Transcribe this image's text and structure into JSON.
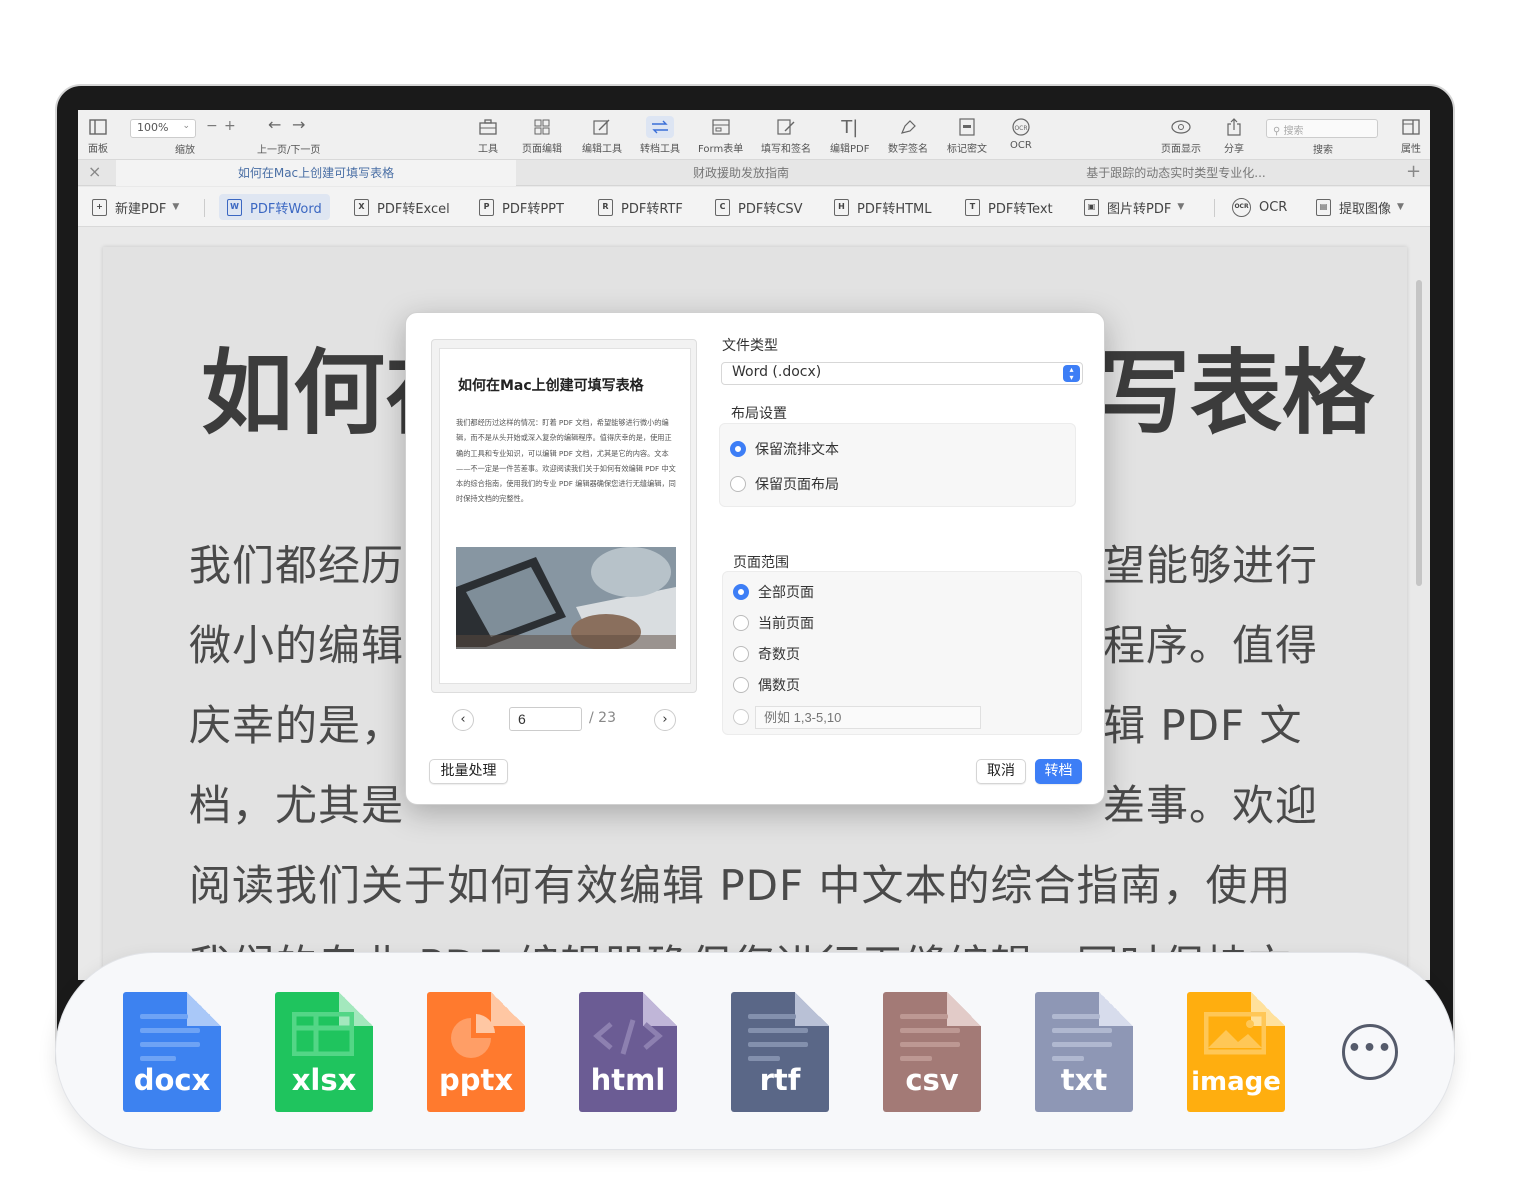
{
  "toolbar": {
    "panel": "面板",
    "zoom_value": "100%",
    "zoom_label": "缩放",
    "prev_next": "上一页/下一页",
    "tools": "工具",
    "page_edit": "页面编辑",
    "edit_tools": "编辑工具",
    "convert_tools": "转档工具",
    "form": "Form表单",
    "fill_sign": "填写和签名",
    "edit_pdf": "编辑PDF",
    "digital_sign": "数字签名",
    "redact": "标记密文",
    "ocr": "OCR",
    "page_display": "页面显示",
    "share": "分享",
    "search_placeholder": "搜索",
    "search_label": "搜索",
    "properties": "属性"
  },
  "tabs": [
    {
      "label": "如何在Mac上创建可填写表格"
    },
    {
      "label": "财政援助发放指南"
    },
    {
      "label": "基于跟踪的动态实时类型专业化..."
    }
  ],
  "convert_bar": {
    "new_pdf": "新建PDF",
    "to_word": "PDF转Word",
    "to_excel": "PDF转Excel",
    "to_ppt": "PDF转PPT",
    "to_rtf": "PDF转RTF",
    "to_csv": "PDF转CSV",
    "to_html": "PDF转HTML",
    "to_text": "PDF转Text",
    "image_to_pdf": "图片转PDF",
    "ocr": "OCR",
    "extract_image": "提取图像"
  },
  "document": {
    "title_left": "如何在",
    "title_right": "写表格",
    "lines": [
      {
        "left": "我们都经历",
        "right": "望能够进行"
      },
      {
        "left": "微小的编辑",
        "right": "程序。值得"
      },
      {
        "left": "庆幸的是，",
        "right": "辑 PDF 文"
      },
      {
        "left": "档，尤其是",
        "right": "差事。欢迎"
      },
      {
        "full": "阅读我们关于如何有效编辑 PDF 中文本的综合指南，使用"
      },
      {
        "full": "我们的专业 PDF 编辑器确保您进行无缝编辑，同时保持文"
      }
    ]
  },
  "dialog": {
    "preview_title": "如何在Mac上创建可填写表格",
    "preview_text": "我们都经历过这样的情况：盯着 PDF 文档，希望能够进行微小的编辑，而不是从头开始或深入复杂的编辑程序。值得庆幸的是，使用正确的工具和专业知识，可以编辑 PDF 文档，尤其是它的内容。文本——不一定是一件苦差事。欢迎阅读我们关于如何有效编辑 PDF 中文本的综合指南，使用我们的专业 PDF 编辑器确保您进行无缝编辑，同时保持文档的完整性。",
    "current_page": "6",
    "total_pages": "/ 23",
    "file_type_label": "文件类型",
    "file_type_value": "Word (.docx)",
    "layout_label": "布局设置",
    "layout_options": [
      "保留流排文本",
      "保留页面布局"
    ],
    "range_label": "页面范围",
    "range_options": [
      "全部页面",
      "当前页面",
      "奇数页",
      "偶数页"
    ],
    "range_placeholder": "例如 1,3-5,10",
    "batch_button": "批量处理",
    "cancel_button": "取消",
    "convert_button": "转档"
  },
  "formats": [
    {
      "name": "docx",
      "color": "#3d82f0",
      "fold": "#a9c8f8",
      "line": "#6ea3f5"
    },
    {
      "name": "xlsx",
      "color": "#1fc45e",
      "fold": "#a3e8bd",
      "line": "#53d686"
    },
    {
      "name": "pptx",
      "color": "#ff7a2e",
      "fold": "#ffc7a3",
      "line": "#ff9e66"
    },
    {
      "name": "html",
      "color": "#6b5c94",
      "fold": "#c0b6d8",
      "line": "#8d80b0"
    },
    {
      "name": "rtf",
      "color": "#5a6787",
      "fold": "#b9c1d6",
      "line": "#8390ad"
    },
    {
      "name": "csv",
      "color": "#a37a76",
      "fold": "#e2cbc8",
      "line": "#bd9893"
    },
    {
      "name": "txt",
      "color": "#8e97b5",
      "fold": "#d7dcec",
      "line": "#b0b8d0"
    },
    {
      "name": "image",
      "color": "#ffae0f",
      "fold": "#ffe19c",
      "line": "#ffc756"
    }
  ],
  "more_icon": "•••"
}
